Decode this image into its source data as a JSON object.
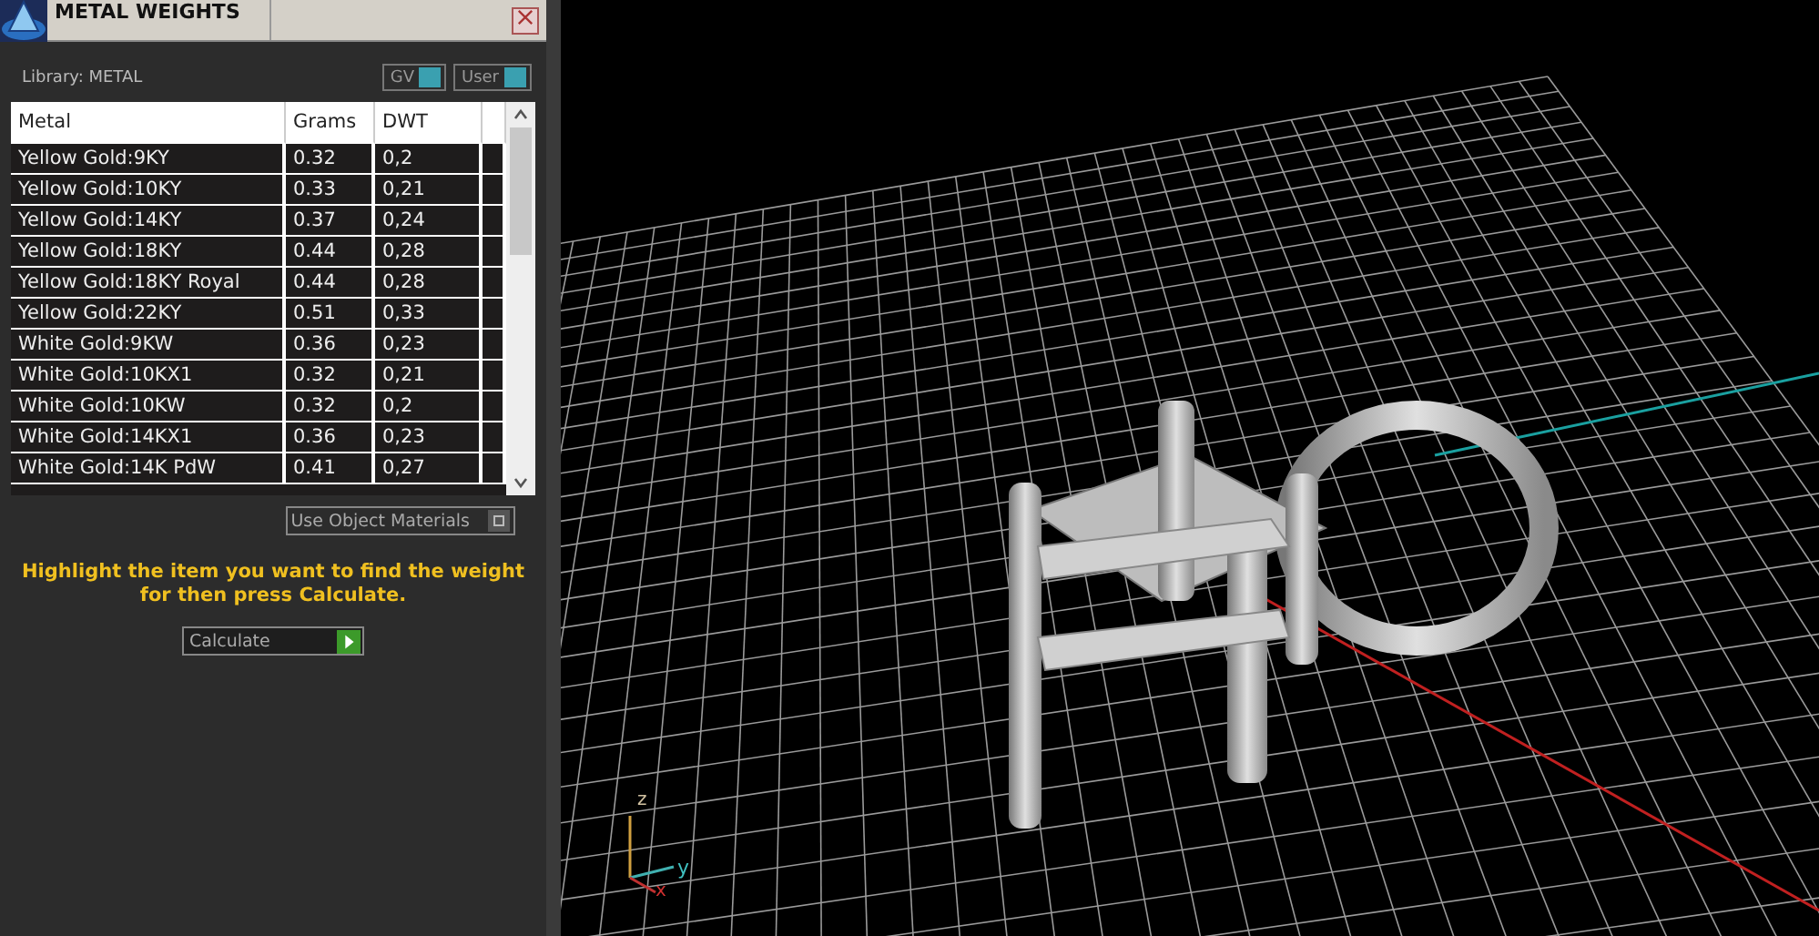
{
  "panel": {
    "title": "METAL WEIGHTS",
    "library_label": "Library: METAL",
    "toggles": [
      {
        "label": "GV",
        "on": true
      },
      {
        "label": "User",
        "on": true
      }
    ],
    "columns": [
      "Metal",
      "Grams",
      "DWT"
    ],
    "rows": [
      {
        "metal": "Yellow Gold:9KY",
        "grams": "0.32",
        "dwt": "0,2"
      },
      {
        "metal": "Yellow Gold:10KY",
        "grams": "0.33",
        "dwt": "0,21"
      },
      {
        "metal": "Yellow Gold:14KY",
        "grams": "0.37",
        "dwt": "0,24"
      },
      {
        "metal": "Yellow Gold:18KY",
        "grams": "0.44",
        "dwt": "0,28"
      },
      {
        "metal": "Yellow Gold:18KY Royal",
        "grams": "0.44",
        "dwt": "0,28"
      },
      {
        "metal": "Yellow Gold:22KY",
        "grams": "0.51",
        "dwt": "0,33"
      },
      {
        "metal": "White Gold:9KW",
        "grams": "0.36",
        "dwt": "0,23"
      },
      {
        "metal": "White Gold:10KX1",
        "grams": "0.32",
        "dwt": "0,21"
      },
      {
        "metal": "White Gold:10KW",
        "grams": "0.32",
        "dwt": "0,2"
      },
      {
        "metal": "White Gold:14KX1",
        "grams": "0.36",
        "dwt": "0,23"
      },
      {
        "metal": "White Gold:14K PdW",
        "grams": "0.41",
        "dwt": "0,27"
      }
    ],
    "use_object_materials": {
      "label": "Use Object Materials",
      "on": false
    },
    "instructions": "Highlight the item you want to find the weight for then press Calculate.",
    "calculate_button": "Calculate"
  },
  "viewport": {
    "axis_labels": {
      "z": "z",
      "y": "y",
      "x": "x"
    }
  }
}
